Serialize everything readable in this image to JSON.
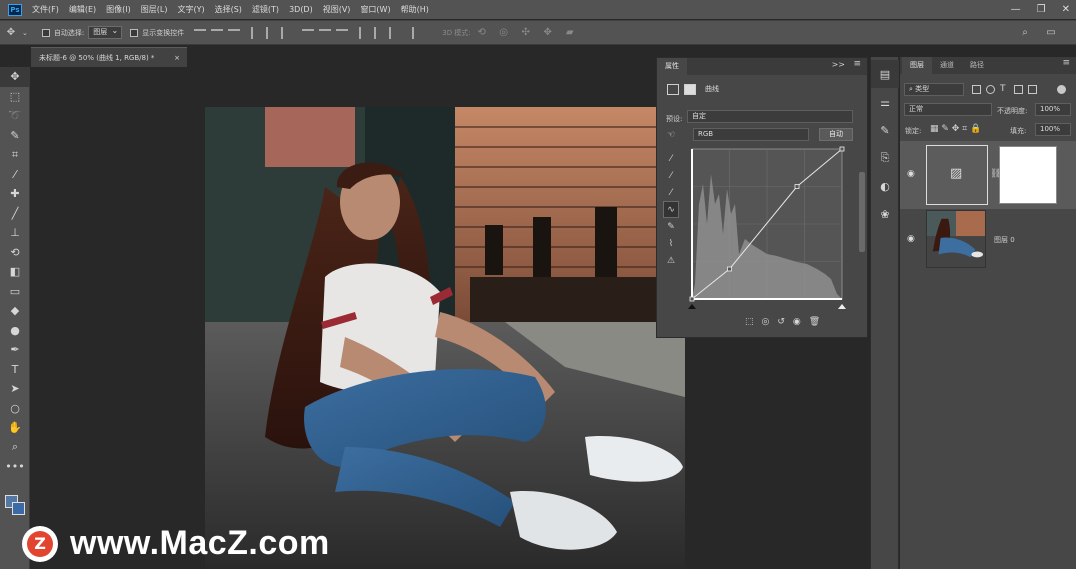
{
  "app": {
    "logo": "Ps"
  },
  "menu": [
    "文件(F)",
    "编辑(E)",
    "图像(I)",
    "图层(L)",
    "文字(Y)",
    "选择(S)",
    "滤镜(T)",
    "3D(D)",
    "视图(V)",
    "窗口(W)",
    "帮助(H)"
  ],
  "window_controls": {
    "minimize": "—",
    "restore": "❐",
    "close": "✕"
  },
  "options": {
    "auto_select_label": "自动选择:",
    "auto_select_value": "图层",
    "transform_controls_label": "显示变换控件",
    "mode_3d_label": "3D 模式:"
  },
  "document_tab": {
    "title": "未标题-6 @ 50% (曲线 1, RGB/8) *",
    "close": "×"
  },
  "properties": {
    "tab": "属性",
    "title": "曲线",
    "preset_label": "预设:",
    "preset_value": "自定",
    "channel_value": "RGB",
    "auto_button": "自动",
    "collapse": ">>",
    "menu": "≡",
    "curve_points": [
      [
        0,
        0
      ],
      [
        0.25,
        0.2
      ],
      [
        0.7,
        0.75
      ],
      [
        1,
        1
      ]
    ]
  },
  "layers": {
    "tabs": [
      "图层",
      "通道",
      "路径"
    ],
    "kind_filter": "类型",
    "blend_mode": "正常",
    "opacity_label": "不透明度:",
    "opacity_value": "100%",
    "lock_label": "锁定:",
    "fill_label": "填充:",
    "fill_value": "100%",
    "rows": [
      {
        "name": "",
        "type": "curves-adjustment"
      },
      {
        "name": "图层 0",
        "type": "pixel"
      }
    ]
  },
  "watermark": {
    "logo_letter": "Z",
    "text": "www.MacZ.com"
  },
  "colors": {
    "foreground": "#5577a4",
    "background": "#3b6aa8",
    "accent": "#2fa3f4"
  }
}
